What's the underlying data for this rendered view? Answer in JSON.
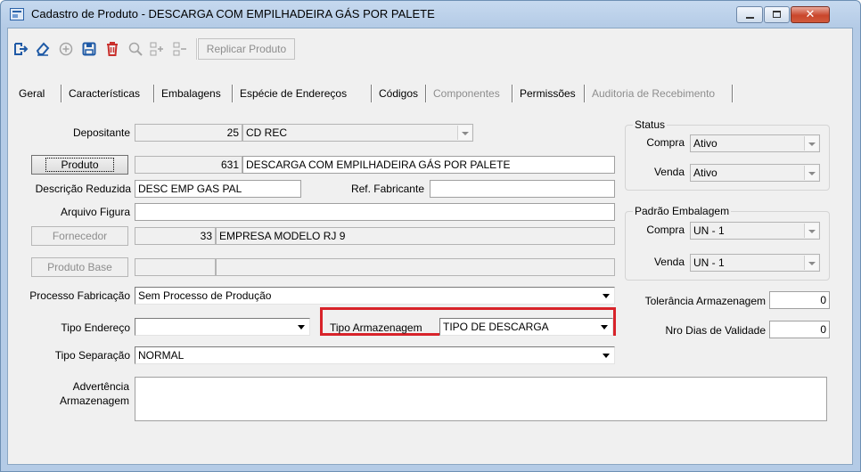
{
  "window": {
    "title": "Cadastro de Produto - DESCARGA COM EMPILHADEIRA GÁS POR PALETE",
    "close_glyph": "✕"
  },
  "toolbar": {
    "replicar_label": "Replicar Produto"
  },
  "tabs": [
    {
      "label": "Geral",
      "disabled": false
    },
    {
      "label": "Características",
      "disabled": false
    },
    {
      "label": "Embalagens",
      "disabled": false
    },
    {
      "label": "Espécie de Endereços",
      "disabled": false
    },
    {
      "label": "Códigos",
      "disabled": false
    },
    {
      "label": "Componentes",
      "disabled": true
    },
    {
      "label": "Permissões",
      "disabled": false
    },
    {
      "label": "Auditoria de Recebimento",
      "disabled": true
    }
  ],
  "form": {
    "depositante": {
      "label": "Depositante",
      "code": "25",
      "name": "CD REC"
    },
    "produto": {
      "button": "Produto",
      "code": "631",
      "name": "DESCARGA COM EMPILHADEIRA GÁS POR PALETE"
    },
    "descricao_reduzida": {
      "label": "Descrição Reduzida",
      "value": "DESC EMP GAS PAL"
    },
    "ref_fabricante": {
      "label": "Ref. Fabricante",
      "value": ""
    },
    "arquivo_figura": {
      "label": "Arquivo Figura",
      "value": ""
    },
    "fornecedor": {
      "button": "Fornecedor",
      "code": "33",
      "name": "EMPRESA MODELO RJ 9"
    },
    "produto_base": {
      "button": "Produto Base",
      "code": "",
      "name": ""
    },
    "processo_fabricacao": {
      "label": "Processo Fabricação",
      "value": "Sem Processo de Produção"
    },
    "tipo_endereco": {
      "label": "Tipo Endereço",
      "value": ""
    },
    "tipo_armazenagem": {
      "label": "Tipo Armazenagem",
      "value": "TIPO DE DESCARGA"
    },
    "tipo_separacao": {
      "label": "Tipo Separação",
      "value": "NORMAL"
    },
    "advertencia": {
      "label_line1": "Advertência",
      "label_line2": "Armazenagem",
      "value": ""
    }
  },
  "status": {
    "title": "Status",
    "compra_label": "Compra",
    "compra_value": "Ativo",
    "venda_label": "Venda",
    "venda_value": "Ativo"
  },
  "padrao_embalagem": {
    "title": "Padrão Embalagem",
    "compra_label": "Compra",
    "compra_value": "UN - 1",
    "venda_label": "Venda",
    "venda_value": "UN - 1"
  },
  "tolerancia": {
    "label": "Tolerância Armazenagem",
    "value": "0"
  },
  "validade": {
    "label": "Nro Dias de Validade",
    "value": "0"
  },
  "colors": {
    "highlight": "#d8232a",
    "title_bar": "#c6d9ef",
    "close_button": "#c9462c"
  }
}
